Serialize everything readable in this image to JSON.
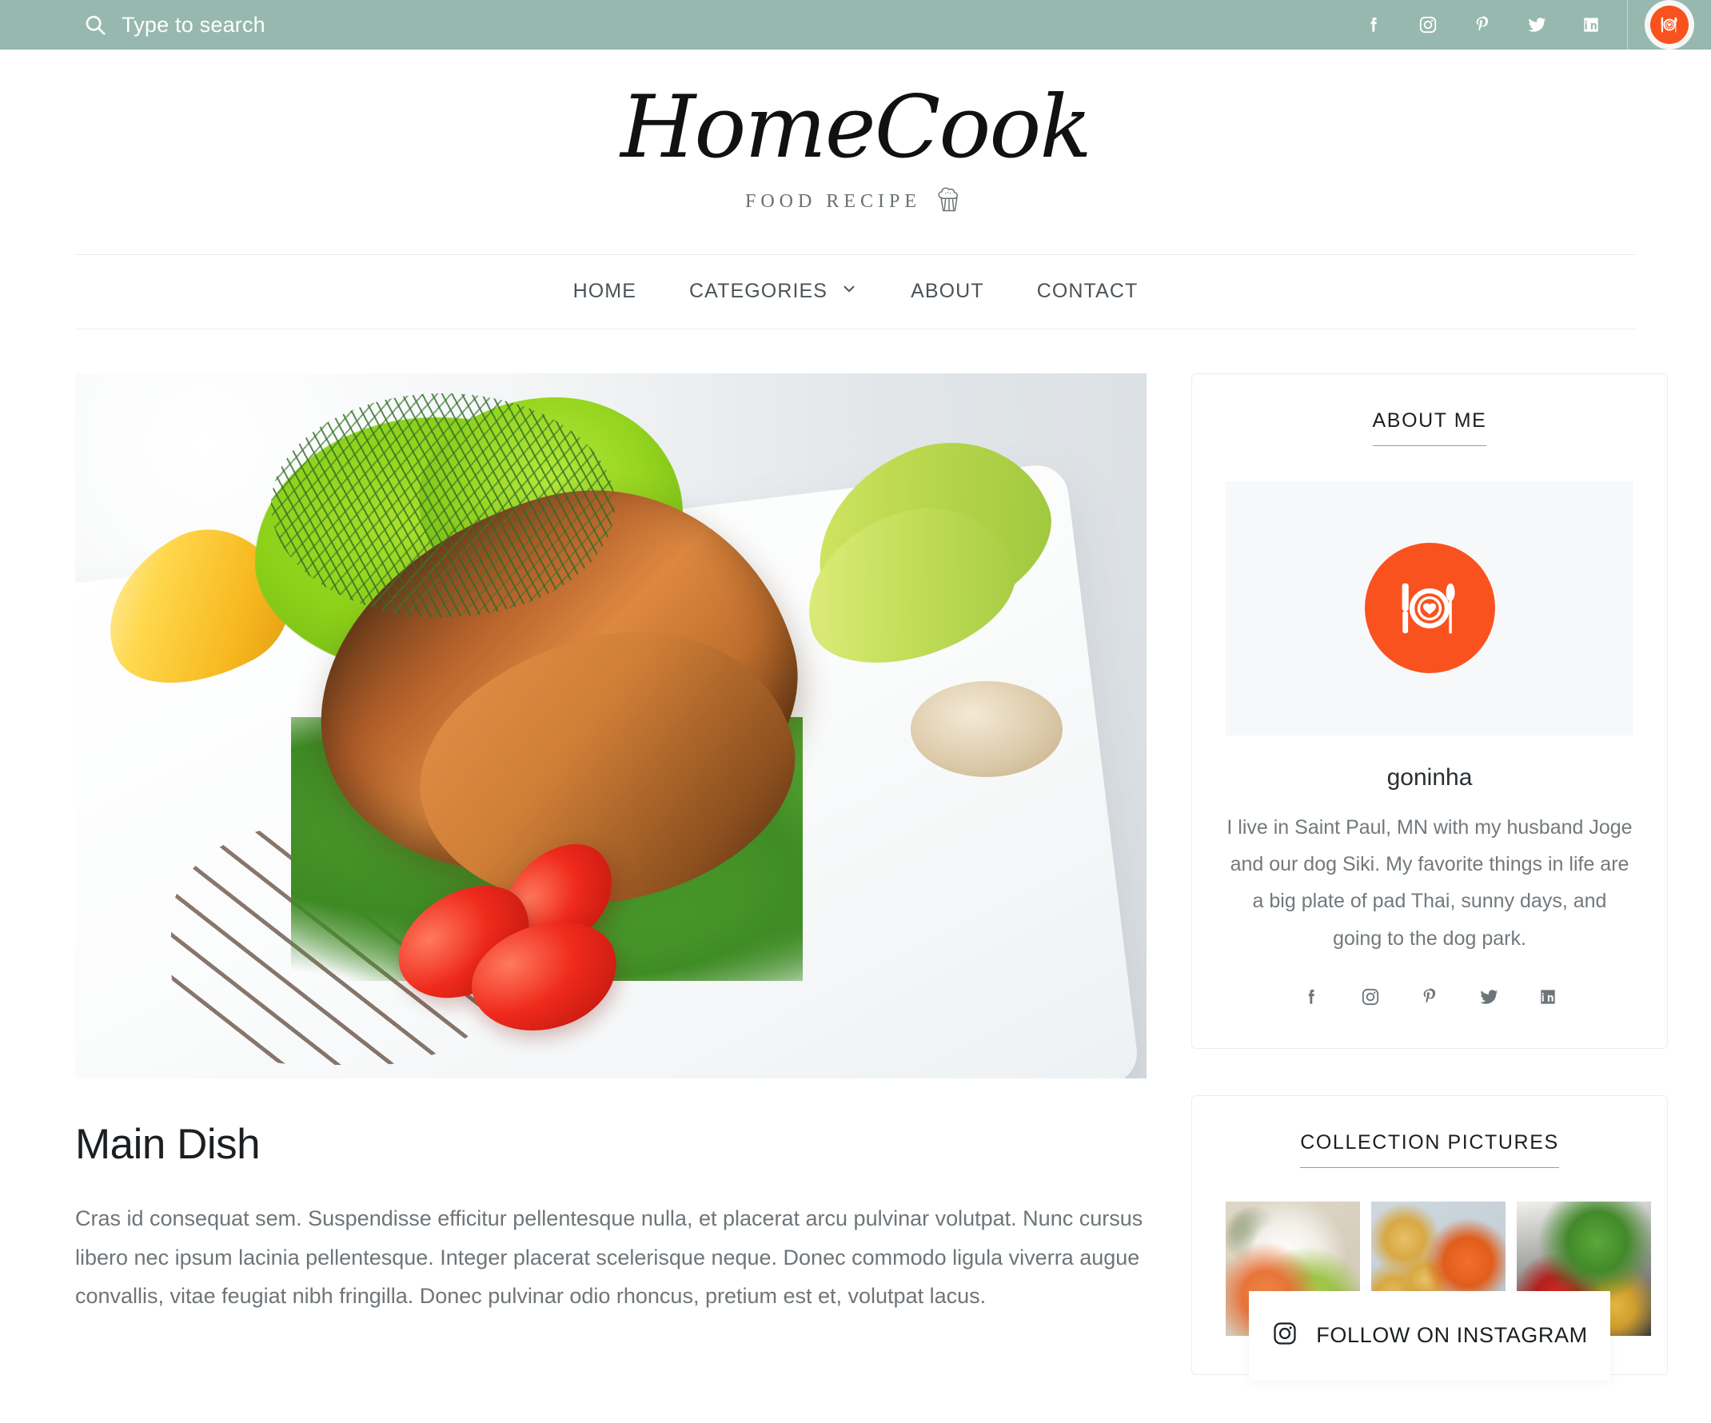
{
  "topbar": {
    "search": {
      "placeholder": "Type to search",
      "value": "",
      "icon": "search-icon"
    },
    "socials": [
      {
        "name": "facebook",
        "label": "Facebook"
      },
      {
        "name": "instagram",
        "label": "Instagram"
      },
      {
        "name": "pinterest",
        "label": "Pinterest"
      },
      {
        "name": "twitter",
        "label": "Twitter"
      },
      {
        "name": "linkedin",
        "label": "LinkedIn"
      }
    ],
    "brand_badge_icon": "restaurant-plate-icon",
    "background_color": "#97b8ae"
  },
  "header": {
    "logo_text": "HomeCook",
    "tagline": "FOOD RECIPE",
    "tagline_icon": "cupcake-icon"
  },
  "nav": {
    "items": [
      {
        "label": "HOME",
        "has_dropdown": false
      },
      {
        "label": "CATEGORIES",
        "has_dropdown": true
      },
      {
        "label": "ABOUT",
        "has_dropdown": false
      },
      {
        "label": "CONTACT",
        "has_dropdown": false
      }
    ]
  },
  "article": {
    "title": "Main Dish",
    "body": "Cras id consequat sem. Suspendisse efficitur pellentesque nulla, et placerat arcu pulvinar volutpat. Nunc cursus libero nec ipsum lacinia pellentesque. Integer placerat scelerisque neque. Donec commodo ligula viverra augue convallis, vitae feugiat nibh fringilla. Donec pulvinar odio rhoncus, pretium est et, volutpat lacus.",
    "hero_image_alt": "Grilled salmon steak with dill, lettuce, avocado and cherry tomatoes on a white plate"
  },
  "sidebar": {
    "about": {
      "title": "ABOUT ME",
      "avatar_icon": "restaurant-plate-icon",
      "name": "goninha",
      "bio": "I live in Saint Paul, MN with my husband Joge and our dog Siki. My favorite things in life are a big plate of pad Thai, sunny days, and going to the dog park.",
      "socials": [
        {
          "name": "facebook",
          "label": "Facebook"
        },
        {
          "name": "instagram",
          "label": "Instagram"
        },
        {
          "name": "pinterest",
          "label": "Pinterest"
        },
        {
          "name": "twitter",
          "label": "Twitter"
        },
        {
          "name": "linkedin",
          "label": "LinkedIn"
        }
      ]
    },
    "collection": {
      "title": "COLLECTION PICTURES",
      "thumbs": [
        {
          "alt": "Salmon rice bowl with avocado and sesame"
        },
        {
          "alt": "Fried potato croquettes with romesco dipping sauce"
        },
        {
          "alt": "Fresh salad with cilantro, peppers and tomatoes"
        }
      ],
      "follow_button": {
        "label": "FOLLOW ON INSTAGRAM",
        "icon": "instagram-icon"
      }
    }
  },
  "colors": {
    "topbar_green": "#97b8ae",
    "accent_orange": "#f9521e",
    "text_dark": "#1b1f22",
    "text_muted": "#72797d",
    "border_light": "#ededed"
  }
}
